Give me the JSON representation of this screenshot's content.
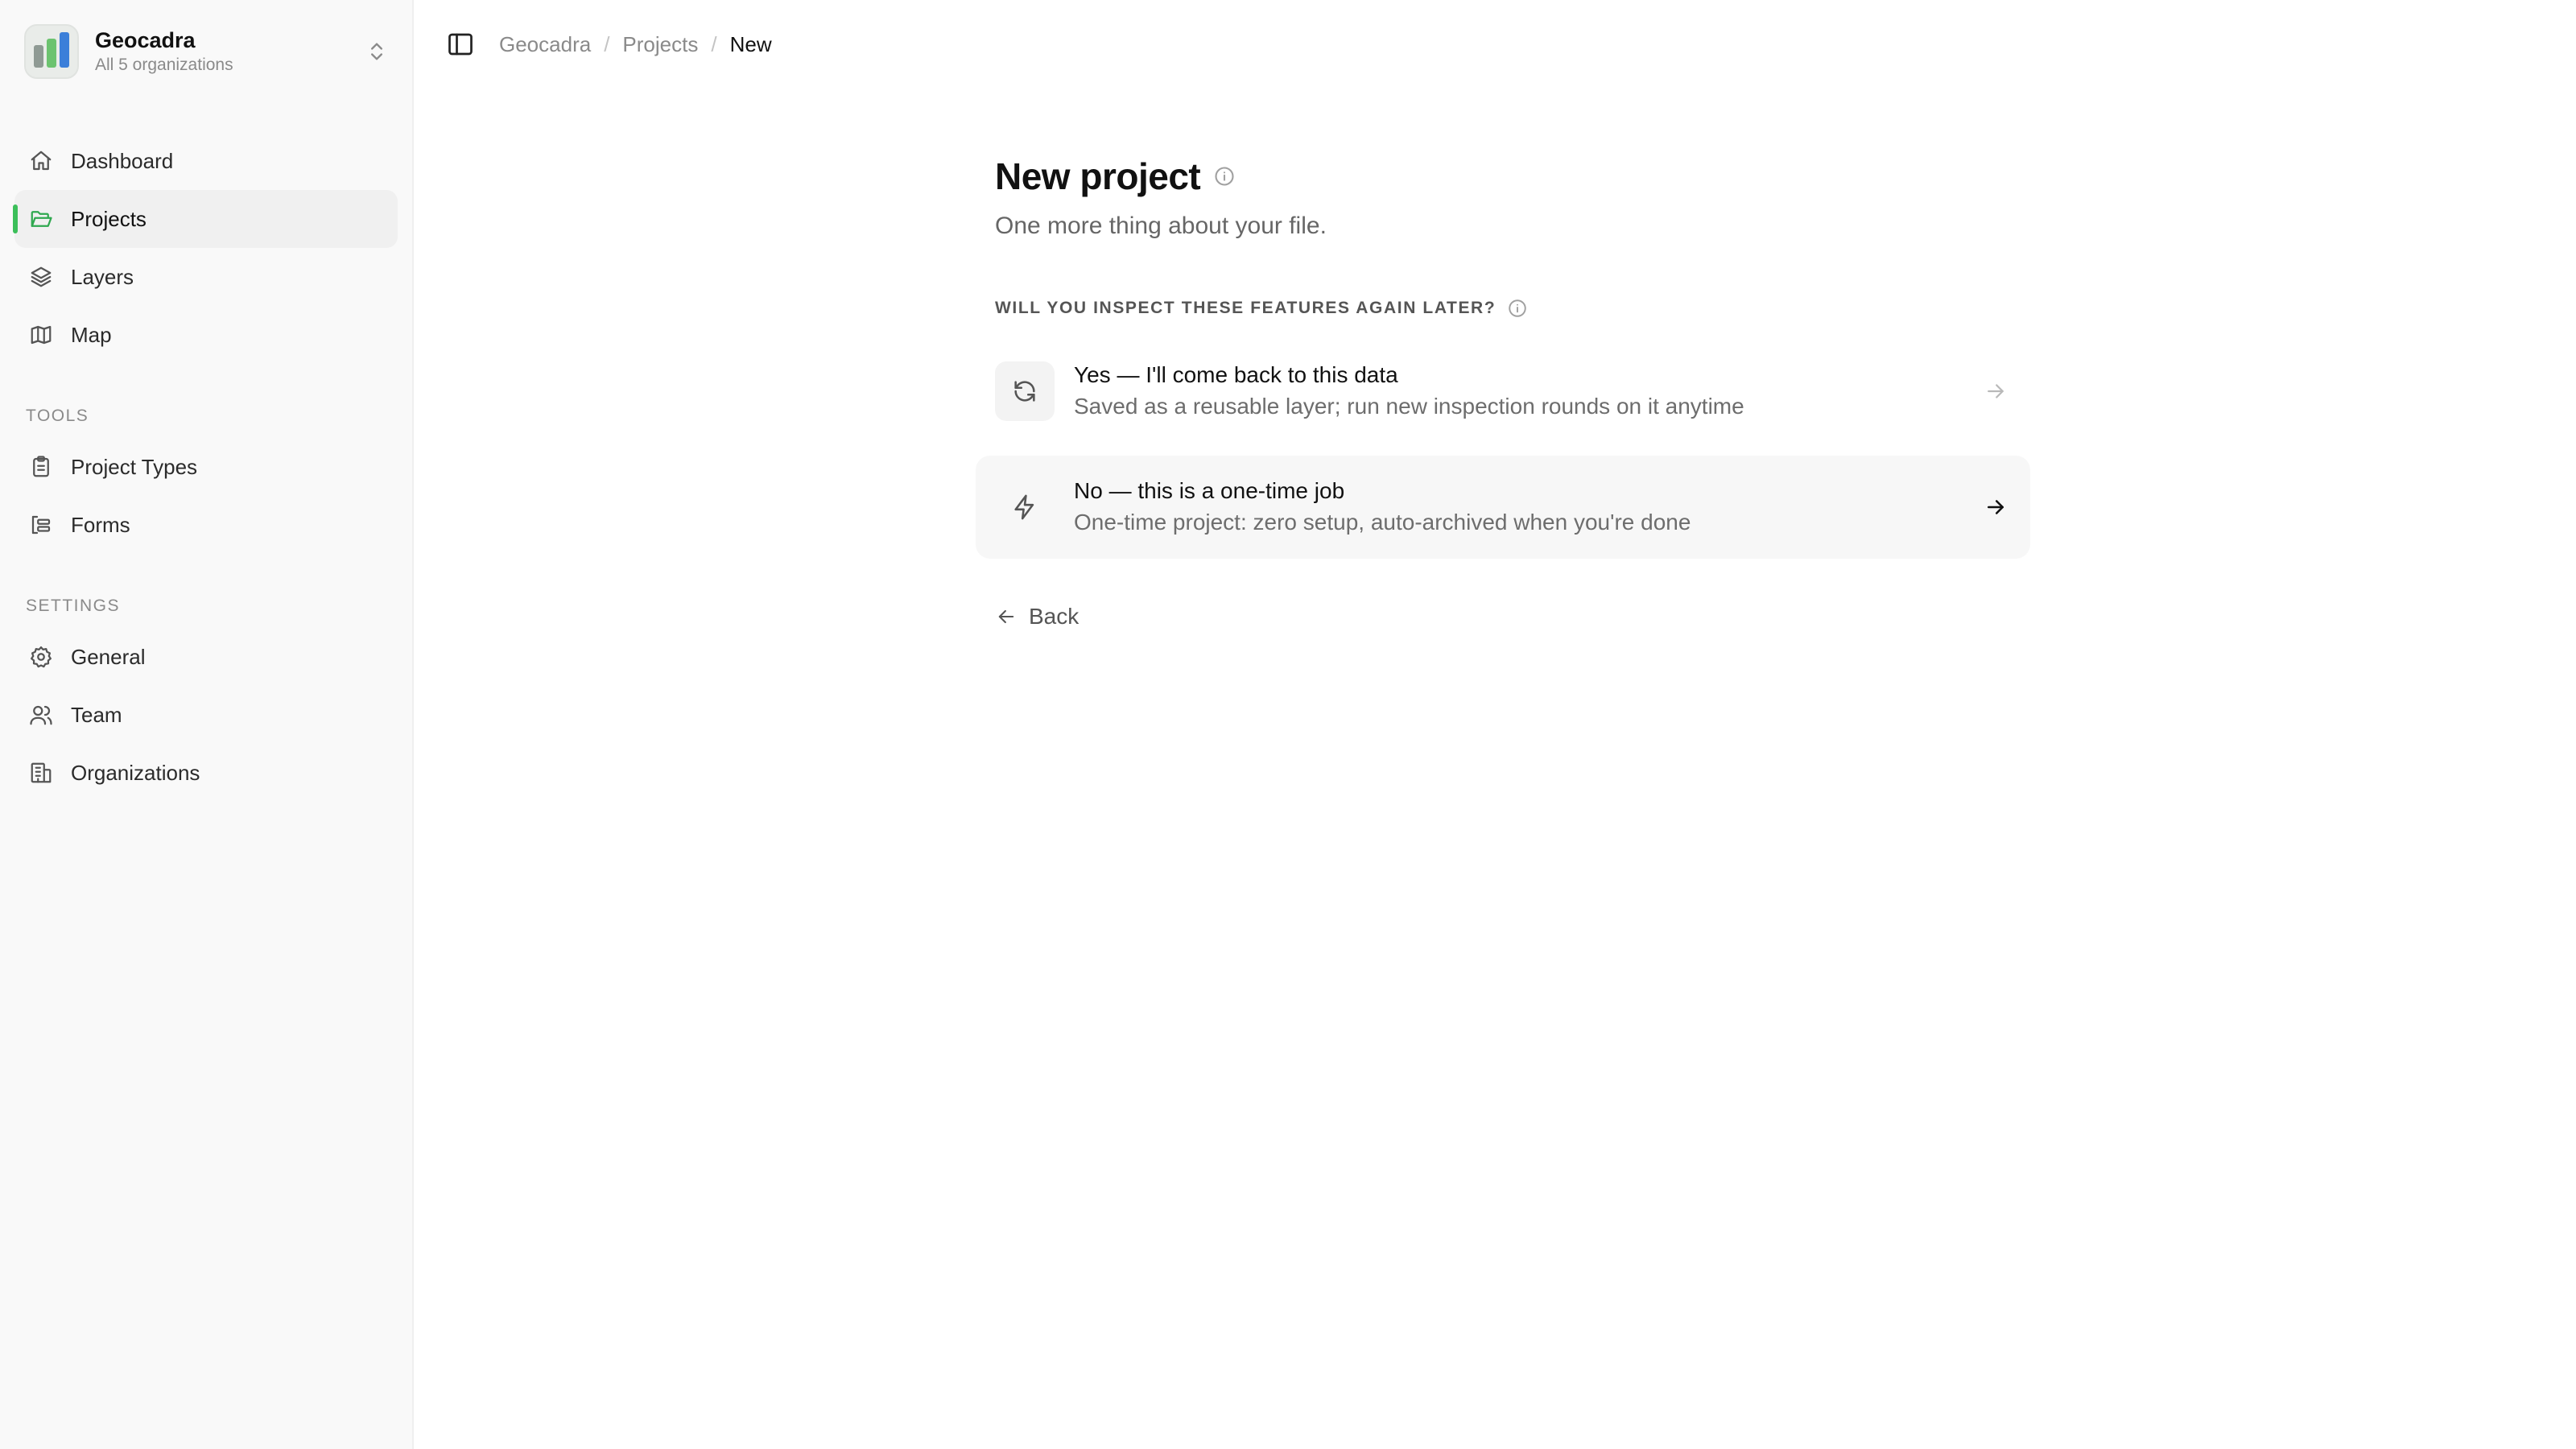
{
  "org": {
    "name": "Geocadra",
    "subtitle": "All 5 organizations",
    "logo_colors": [
      "#8f9a94",
      "#6cc36f",
      "#3b7fd9"
    ]
  },
  "nav": {
    "main": [
      {
        "label": "Dashboard",
        "icon": "home-icon",
        "active": false
      },
      {
        "label": "Projects",
        "icon": "folder-open-icon",
        "active": true
      },
      {
        "label": "Layers",
        "icon": "layers-icon",
        "active": false
      },
      {
        "label": "Map",
        "icon": "map-icon",
        "active": false
      }
    ],
    "tools_label": "TOOLS",
    "tools": [
      {
        "label": "Project Types",
        "icon": "clipboard-icon"
      },
      {
        "label": "Forms",
        "icon": "form-icon"
      }
    ],
    "settings_label": "SETTINGS",
    "settings": [
      {
        "label": "General",
        "icon": "gear-icon"
      },
      {
        "label": "Team",
        "icon": "users-icon"
      },
      {
        "label": "Organizations",
        "icon": "building-icon"
      }
    ]
  },
  "breadcrumb": [
    "Geocadra",
    "Projects",
    "New"
  ],
  "page": {
    "title": "New project",
    "subtitle": "One more thing about your file.",
    "question": "WILL YOU INSPECT THESE FEATURES AGAIN LATER?",
    "options": [
      {
        "title": "Yes — I'll come back to this data",
        "description": "Saved as a reusable layer; run new inspection rounds on it anytime",
        "icon": "refresh-icon"
      },
      {
        "title": "No — this is a one-time job",
        "description": "One-time project: zero setup, auto-archived when you're done",
        "icon": "lightning-icon"
      }
    ],
    "back_label": "Back"
  },
  "colors": {
    "accent": "#3cbf5a",
    "sidebar_bg": "#f9f9f9"
  }
}
